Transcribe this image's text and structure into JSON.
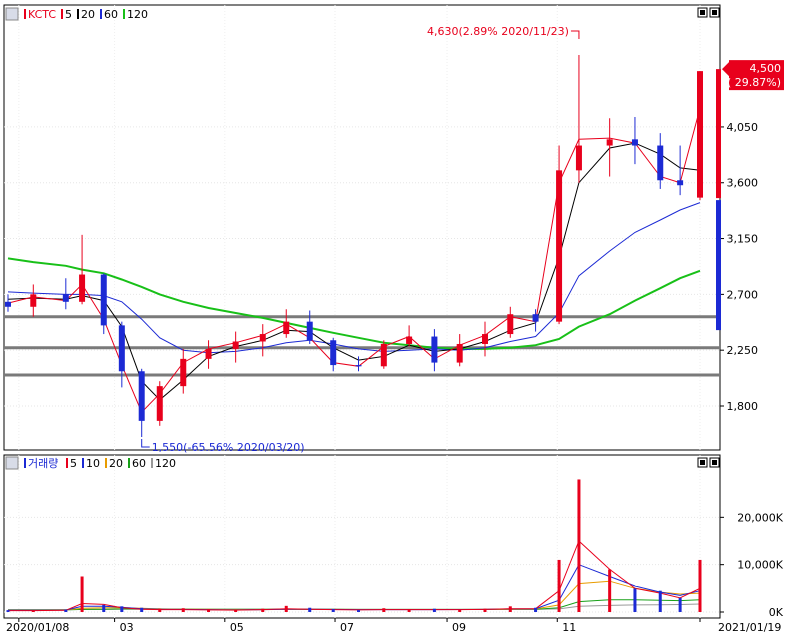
{
  "chart_data": [
    {
      "type": "candlestick",
      "panel": "price",
      "legend": [
        {
          "label": "KCTC",
          "color": "#e8001c"
        },
        {
          "label": "5",
          "color": "#e8001c"
        },
        {
          "label": "20",
          "color": "#000000"
        },
        {
          "label": "60",
          "color": "#1c2ad4"
        },
        {
          "label": "120",
          "color": "#18c018"
        }
      ],
      "y_ticks": [
        "4,050",
        "3,600",
        "3,150",
        "2,700",
        "2,250",
        "1,800"
      ],
      "y_tick_values": [
        4050,
        3600,
        3150,
        2700,
        2250,
        1800
      ],
      "ylim": [
        1550,
        4630
      ],
      "x_ticks": [
        "2020/01/08",
        "03",
        "05",
        "07",
        "09",
        "11",
        "2021/01/19"
      ],
      "x_tick_dates": [
        "2020-01-08",
        "2020-03-01",
        "2020-05-01",
        "2020-07-01",
        "2020-09-01",
        "2020-11-01",
        "2021-01-19"
      ],
      "x_range": [
        "2020-01-02",
        "2021-01-19"
      ],
      "support_lines": [
        2520,
        2270,
        2050
      ],
      "annotation_high": "4,630(2.89% 2020/11/23)",
      "annotation_low": "1,550(-65.56% 2020/03/20)",
      "current_price": "4,500",
      "current_change": "( 29.87%)",
      "ohlc": [
        [
          "2020-01-02",
          2640,
          2700,
          2560,
          2600
        ],
        [
          "2020-01-16",
          2600,
          2780,
          2520,
          2700
        ],
        [
          "2020-02-03",
          2700,
          2830,
          2580,
          2640
        ],
        [
          "2020-02-12",
          2640,
          3180,
          2620,
          2860
        ],
        [
          "2020-02-24",
          2860,
          2870,
          2380,
          2450
        ],
        [
          "2020-03-05",
          2450,
          2480,
          1950,
          2080
        ],
        [
          "2020-03-16",
          2080,
          2100,
          1550,
          1680
        ],
        [
          "2020-03-26",
          1680,
          2000,
          1640,
          1960
        ],
        [
          "2020-04-08",
          1960,
          2260,
          1900,
          2180
        ],
        [
          "2020-04-22",
          2180,
          2330,
          2100,
          2260
        ],
        [
          "2020-05-07",
          2260,
          2400,
          2150,
          2320
        ],
        [
          "2020-05-22",
          2320,
          2460,
          2200,
          2380
        ],
        [
          "2020-06-04",
          2380,
          2580,
          2350,
          2480
        ],
        [
          "2020-06-17",
          2480,
          2570,
          2300,
          2330
        ],
        [
          "2020-06-30",
          2330,
          2350,
          2080,
          2130
        ],
        [
          "2020-07-14",
          2130,
          2200,
          2080,
          2120
        ],
        [
          "2020-07-28",
          2120,
          2330,
          2100,
          2300
        ],
        [
          "2020-08-11",
          2300,
          2450,
          2280,
          2360
        ],
        [
          "2020-08-25",
          2360,
          2420,
          2080,
          2150
        ],
        [
          "2020-09-08",
          2150,
          2380,
          2120,
          2300
        ],
        [
          "2020-09-22",
          2300,
          2480,
          2200,
          2380
        ],
        [
          "2020-10-06",
          2380,
          2600,
          2350,
          2540
        ],
        [
          "2020-10-20",
          2540,
          2580,
          2400,
          2480
        ],
        [
          "2020-11-02",
          2480,
          3900,
          2460,
          3700
        ],
        [
          "2020-11-13",
          3700,
          4630,
          3600,
          3900
        ],
        [
          "2020-11-30",
          3900,
          4120,
          3650,
          3950
        ],
        [
          "2020-12-14",
          3950,
          4130,
          3750,
          3900
        ],
        [
          "2020-12-28",
          3900,
          4000,
          3550,
          3620
        ],
        [
          "2021-01-08",
          3620,
          3900,
          3500,
          3580
        ],
        [
          "2021-01-19",
          3480,
          4500,
          3460,
          4500
        ]
      ],
      "ma": {
        "5": [
          2630,
          2680,
          2650,
          2780,
          2500,
          2130,
          1750,
          1900,
          2150,
          2260,
          2310,
          2370,
          2460,
          2350,
          2150,
          2120,
          2280,
          2360,
          2180,
          2290,
          2370,
          2520,
          2480,
          3600,
          3950,
          3960,
          3920,
          3650,
          3600,
          4200
        ],
        "20": [
          2660,
          2670,
          2660,
          2690,
          2650,
          2440,
          2000,
          1850,
          2010,
          2200,
          2280,
          2330,
          2410,
          2400,
          2270,
          2170,
          2200,
          2290,
          2240,
          2260,
          2320,
          2410,
          2470,
          3000,
          3600,
          3880,
          3920,
          3830,
          3720,
          3700
        ],
        "60": [
          2720,
          2710,
          2700,
          2700,
          2690,
          2640,
          2500,
          2350,
          2250,
          2230,
          2240,
          2270,
          2310,
          2330,
          2300,
          2260,
          2240,
          2250,
          2260,
          2250,
          2270,
          2320,
          2360,
          2550,
          2850,
          3050,
          3200,
          3300,
          3380,
          3440
        ],
        "120": [
          2990,
          2960,
          2930,
          2900,
          2870,
          2820,
          2760,
          2700,
          2640,
          2590,
          2550,
          2510,
          2470,
          2430,
          2390,
          2350,
          2310,
          2290,
          2270,
          2260,
          2260,
          2270,
          2290,
          2340,
          2440,
          2540,
          2650,
          2750,
          2830,
          2890
        ]
      }
    },
    {
      "type": "bar",
      "panel": "volume",
      "legend": [
        {
          "label": "거래량",
          "color": "#1c2ad4"
        },
        {
          "label": "5",
          "color": "#e8001c"
        },
        {
          "label": "10",
          "color": "#1c2ad4"
        },
        {
          "label": "20",
          "color": "#e89c00"
        },
        {
          "label": "60",
          "color": "#18a018"
        },
        {
          "label": "120",
          "color": "#999999"
        }
      ],
      "y_ticks": [
        "20,000K",
        "10,000K",
        "0K"
      ],
      "y_tick_values": [
        20000,
        10000,
        0
      ],
      "ylim": [
        0,
        30000
      ],
      "unit": "K",
      "volume": [
        [
          "2020-01-02",
          400
        ],
        [
          "2020-01-16",
          350
        ],
        [
          "2020-02-03",
          500
        ],
        [
          "2020-02-12",
          7500
        ],
        [
          "2020-02-24",
          1500
        ],
        [
          "2020-03-05",
          1200
        ],
        [
          "2020-03-16",
          900
        ],
        [
          "2020-03-26",
          700
        ],
        [
          "2020-04-08",
          800
        ],
        [
          "2020-04-22",
          600
        ],
        [
          "2020-05-07",
          500
        ],
        [
          "2020-05-22",
          700
        ],
        [
          "2020-06-04",
          1300
        ],
        [
          "2020-06-17",
          900
        ],
        [
          "2020-06-30",
          600
        ],
        [
          "2020-07-14",
          400
        ],
        [
          "2020-07-28",
          800
        ],
        [
          "2020-08-11",
          600
        ],
        [
          "2020-08-25",
          700
        ],
        [
          "2020-09-08",
          500
        ],
        [
          "2020-09-22",
          700
        ],
        [
          "2020-10-06",
          1200
        ],
        [
          "2020-10-20",
          900
        ],
        [
          "2020-11-02",
          11000
        ],
        [
          "2020-11-13",
          28000
        ],
        [
          "2020-11-30",
          9000
        ],
        [
          "2020-12-14",
          5000
        ],
        [
          "2020-12-28",
          4500
        ],
        [
          "2021-01-08",
          3000
        ],
        [
          "2021-01-19",
          11000
        ]
      ],
      "vma": {
        "5": [
          300,
          300,
          350,
          1800,
          1600,
          900,
          600,
          500,
          500,
          450,
          400,
          500,
          700,
          600,
          500,
          450,
          500,
          500,
          500,
          500,
          550,
          700,
          700,
          4500,
          15000,
          9000,
          5000,
          4000,
          3000,
          5000
        ],
        "10": [
          350,
          350,
          400,
          1200,
          1200,
          1000,
          700,
          600,
          550,
          500,
          450,
          500,
          600,
          600,
          550,
          500,
          500,
          500,
          500,
          520,
          550,
          650,
          700,
          2500,
          10000,
          7500,
          5500,
          4200,
          3500,
          4500
        ],
        "20": [
          400,
          400,
          420,
          800,
          900,
          900,
          800,
          650,
          600,
          550,
          500,
          500,
          550,
          550,
          550,
          520,
          520,
          520,
          520,
          520,
          540,
          600,
          650,
          1500,
          6000,
          6500,
          5000,
          4200,
          3800,
          4000
        ],
        "60": [
          450,
          450,
          450,
          550,
          600,
          650,
          650,
          650,
          620,
          600,
          580,
          570,
          570,
          570,
          560,
          550,
          540,
          540,
          540,
          540,
          540,
          560,
          580,
          900,
          2200,
          2600,
          2600,
          2500,
          2400,
          2600
        ],
        "120": [
          500,
          500,
          500,
          520,
          540,
          560,
          570,
          580,
          580,
          580,
          575,
          570,
          565,
          560,
          555,
          550,
          548,
          546,
          545,
          545,
          545,
          548,
          552,
          650,
          1200,
          1400,
          1500,
          1550,
          1580,
          1700
        ]
      }
    }
  ]
}
